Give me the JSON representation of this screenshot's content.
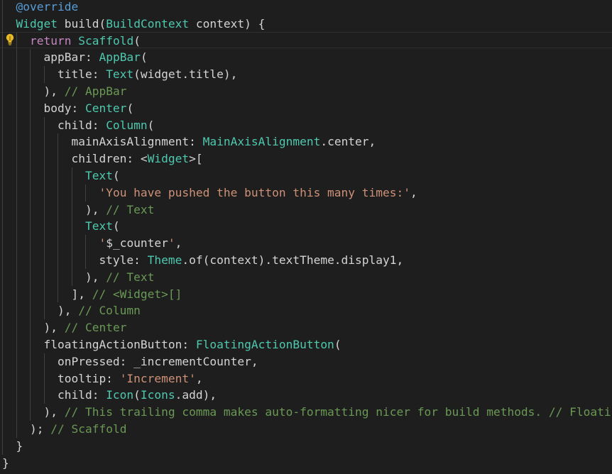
{
  "editor": {
    "theme_colors": {
      "background": "#1e1e1e",
      "plain": "#d4d4d4",
      "decorator": "#569cd6",
      "type": "#4ec9b0",
      "keyword": "#c586c0",
      "string": "#ce9178",
      "comment": "#6a9955",
      "indent_guide": "#404040",
      "lightbulb": "#e8b923"
    },
    "lightbulb_icon": "lightbulb-icon",
    "lines": [
      [
        {
          "t": "  "
        },
        {
          "t": "@override",
          "c": "decorator"
        }
      ],
      [
        {
          "t": "  "
        },
        {
          "t": "Widget",
          "c": "type"
        },
        {
          "t": " build("
        },
        {
          "t": "BuildContext",
          "c": "type"
        },
        {
          "t": " context) {"
        }
      ],
      [
        {
          "t": "    "
        },
        {
          "t": "return",
          "c": "keyword"
        },
        {
          "t": " "
        },
        {
          "t": "Scaffold",
          "c": "type"
        },
        {
          "t": "("
        }
      ],
      [
        {
          "t": "      appBar: "
        },
        {
          "t": "AppBar",
          "c": "type"
        },
        {
          "t": "("
        }
      ],
      [
        {
          "t": "        title: "
        },
        {
          "t": "Text",
          "c": "type"
        },
        {
          "t": "(widget.title),"
        }
      ],
      [
        {
          "t": "      ), "
        },
        {
          "t": "// AppBar",
          "c": "comment"
        }
      ],
      [
        {
          "t": "      body: "
        },
        {
          "t": "Center",
          "c": "type"
        },
        {
          "t": "("
        }
      ],
      [
        {
          "t": "        child: "
        },
        {
          "t": "Column",
          "c": "type"
        },
        {
          "t": "("
        }
      ],
      [
        {
          "t": "          mainAxisAlignment: "
        },
        {
          "t": "MainAxisAlignment",
          "c": "type"
        },
        {
          "t": ".center,"
        }
      ],
      [
        {
          "t": "          children: <"
        },
        {
          "t": "Widget",
          "c": "type"
        },
        {
          "t": ">["
        }
      ],
      [
        {
          "t": "            "
        },
        {
          "t": "Text",
          "c": "type"
        },
        {
          "t": "("
        }
      ],
      [
        {
          "t": "              "
        },
        {
          "t": "'You have pushed the button this many times:'",
          "c": "string"
        },
        {
          "t": ","
        }
      ],
      [
        {
          "t": "            ), "
        },
        {
          "t": "// Text",
          "c": "comment"
        }
      ],
      [
        {
          "t": "            "
        },
        {
          "t": "Text",
          "c": "type"
        },
        {
          "t": "("
        }
      ],
      [
        {
          "t": "              "
        },
        {
          "t": "'",
          "c": "string"
        },
        {
          "t": "$_counter",
          "c": "plain"
        },
        {
          "t": "'",
          "c": "string"
        },
        {
          "t": ","
        }
      ],
      [
        {
          "t": "              style: "
        },
        {
          "t": "Theme",
          "c": "type"
        },
        {
          "t": ".of(context).textTheme.display1,"
        }
      ],
      [
        {
          "t": "            ), "
        },
        {
          "t": "// Text",
          "c": "comment"
        }
      ],
      [
        {
          "t": "          ], "
        },
        {
          "t": "// <Widget>[]",
          "c": "comment"
        }
      ],
      [
        {
          "t": "        ), "
        },
        {
          "t": "// Column",
          "c": "comment"
        }
      ],
      [
        {
          "t": "      ), "
        },
        {
          "t": "// Center",
          "c": "comment"
        }
      ],
      [
        {
          "t": "      floatingActionButton: "
        },
        {
          "t": "FloatingActionButton",
          "c": "type"
        },
        {
          "t": "("
        }
      ],
      [
        {
          "t": "        onPressed: _incrementCounter,"
        }
      ],
      [
        {
          "t": "        tooltip: "
        },
        {
          "t": "'Increment'",
          "c": "string"
        },
        {
          "t": ","
        }
      ],
      [
        {
          "t": "        child: "
        },
        {
          "t": "Icon",
          "c": "type"
        },
        {
          "t": "("
        },
        {
          "t": "Icons",
          "c": "type"
        },
        {
          "t": ".add),"
        }
      ],
      [
        {
          "t": "      ), "
        },
        {
          "t": "// This trailing comma makes auto-formatting nicer for build methods. // FloatingActionButton",
          "c": "comment"
        }
      ],
      [
        {
          "t": "    ); "
        },
        {
          "t": "// Scaffold",
          "c": "comment"
        }
      ],
      [
        {
          "t": "  }"
        }
      ],
      [
        {
          "t": "}"
        }
      ]
    ]
  }
}
